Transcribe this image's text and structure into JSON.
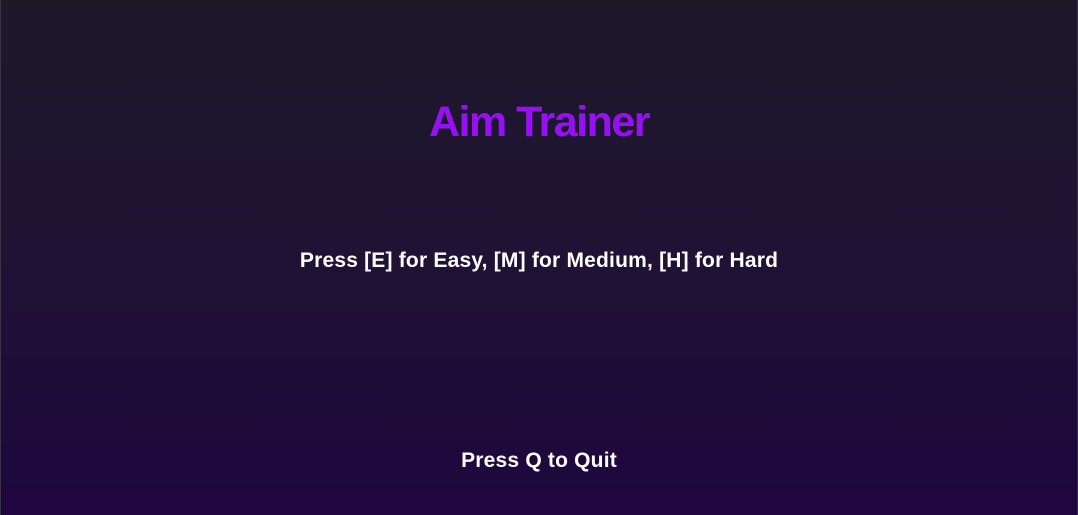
{
  "menu": {
    "title": "Aim Trainer",
    "difficulty_prompt": "Press [E] for Easy, [M] for Medium, [H] for Hard",
    "quit_prompt": "Press Q to Quit"
  },
  "colors": {
    "title": "#9710f4",
    "text": "#ffffff",
    "background_top": "#1d1929",
    "background_bottom": "#1f063e"
  }
}
